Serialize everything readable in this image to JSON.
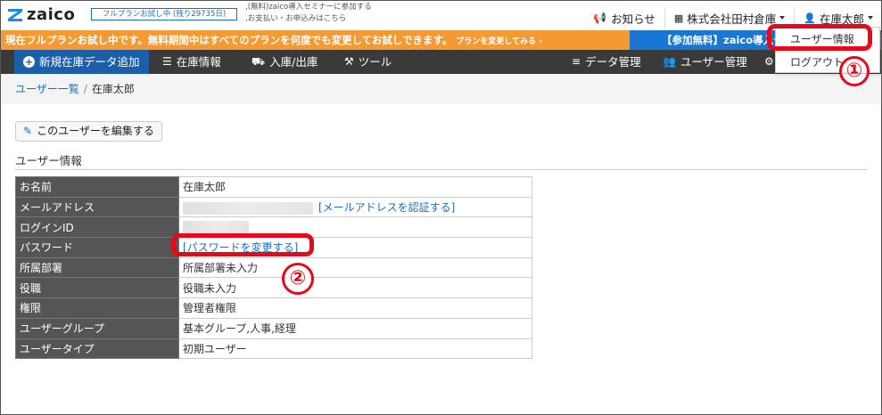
{
  "header": {
    "logo_text": "zaico",
    "trial_badge": "フルプランお試し中 (残り29735日)",
    "links": [
      ",(無料)zaico導入セミナーに参加する",
      ",お支払い・お申込みはこちら"
    ],
    "notice": "お知らせ",
    "company": "株式会社田村倉庫",
    "user": "在庫太郎"
  },
  "banner": {
    "message": "現在フルプランお試し中です。無料期間中はすべてのプランを何度でも変更してお試しできます。",
    "cta": "プランを変更してみる ›",
    "right": "【参加無料】zaico導入セ"
  },
  "nav": {
    "new_item": "新規在庫データ追加",
    "inventory": "在庫情報",
    "inout": "入庫/出庫",
    "tools": "ツール",
    "data_mgmt": "データ管理",
    "user_mgmt": "ユーザー管理"
  },
  "dropdown": {
    "items": [
      "ユーザー情報",
      "ログアウト"
    ]
  },
  "annotations": {
    "step1": "①",
    "step2": "②",
    "highlight_color": "#e8081b"
  },
  "breadcrumb": {
    "parent": "ユーザー一覧",
    "current": "在庫太郎"
  },
  "page": {
    "edit_button": "このユーザーを編集する",
    "section_title": "ユーザー情報"
  },
  "user_info": {
    "rows": [
      {
        "label": "お名前",
        "value": "在庫太郎"
      },
      {
        "label": "メールアドレス",
        "value": "",
        "link": "[メールアドレスを認証する]"
      },
      {
        "label": "ログインID",
        "value": ""
      },
      {
        "label": "パスワード",
        "value": "",
        "link": "[パスワードを変更する]"
      },
      {
        "label": "所属部署",
        "value": "所属部署未入力"
      },
      {
        "label": "役職",
        "value": "役職未入力"
      },
      {
        "label": "権限",
        "value": "管理者権限"
      },
      {
        "label": "ユーザーグループ",
        "value": "基本グループ,人事,経理"
      },
      {
        "label": "ユーザータイプ",
        "value": "初期ユーザー"
      }
    ]
  },
  "colors": {
    "banner_orange": "#f59a33",
    "banner_blue": "#1976d2",
    "nav_bg": "#3a3a3a",
    "nav_new_bg": "#1c5fa8",
    "link": "#1a6fc0"
  }
}
